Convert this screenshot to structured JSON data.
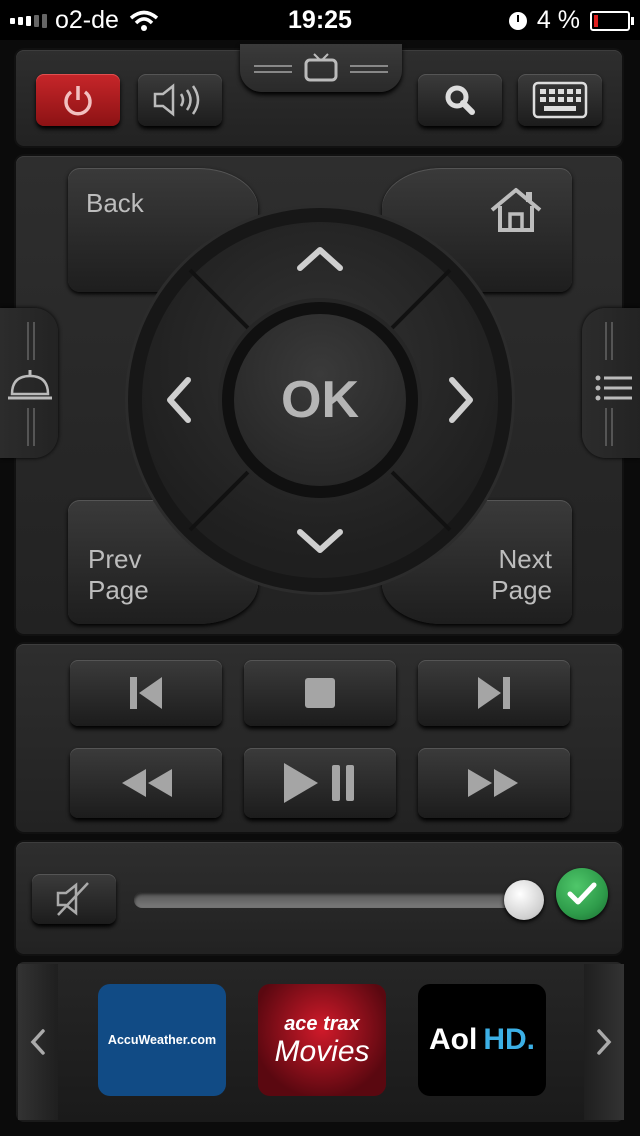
{
  "status_bar": {
    "carrier": "o2-de",
    "time": "19:25",
    "battery": "4 %",
    "battery_level_percent": 4
  },
  "top_controls": {
    "icons": [
      "power-icon",
      "speaker-icon",
      "tv-icon",
      "search-icon",
      "keyboard-icon"
    ],
    "power_color": "#c7262a"
  },
  "navigation": {
    "back_label": "Back",
    "ok_label": "OK",
    "prev_page_label": "Prev\nPage",
    "next_page_label": "Next\nPage",
    "icons": [
      "home-icon",
      "bell-icon",
      "list-icon",
      "up-icon",
      "down-icon",
      "left-icon",
      "right-icon"
    ]
  },
  "transport": {
    "icons": [
      "skip-previous-icon",
      "stop-icon",
      "skip-next-icon",
      "rewind-icon",
      "play-pause-icon",
      "fast-forward-icon"
    ]
  },
  "volume": {
    "level_fraction": 1.0,
    "confirm_color": "#2e9b4a",
    "icons": [
      "mute-icon",
      "checkmark-icon"
    ]
  },
  "apps": [
    {
      "name": "AccuWeather.com",
      "bg": "#114b85"
    },
    {
      "name": "ace trax",
      "subtitle": "Movies",
      "bg": "#8a0d1a"
    },
    {
      "name": "Aol",
      "suffix": "HD.",
      "bg": "#000000"
    }
  ]
}
